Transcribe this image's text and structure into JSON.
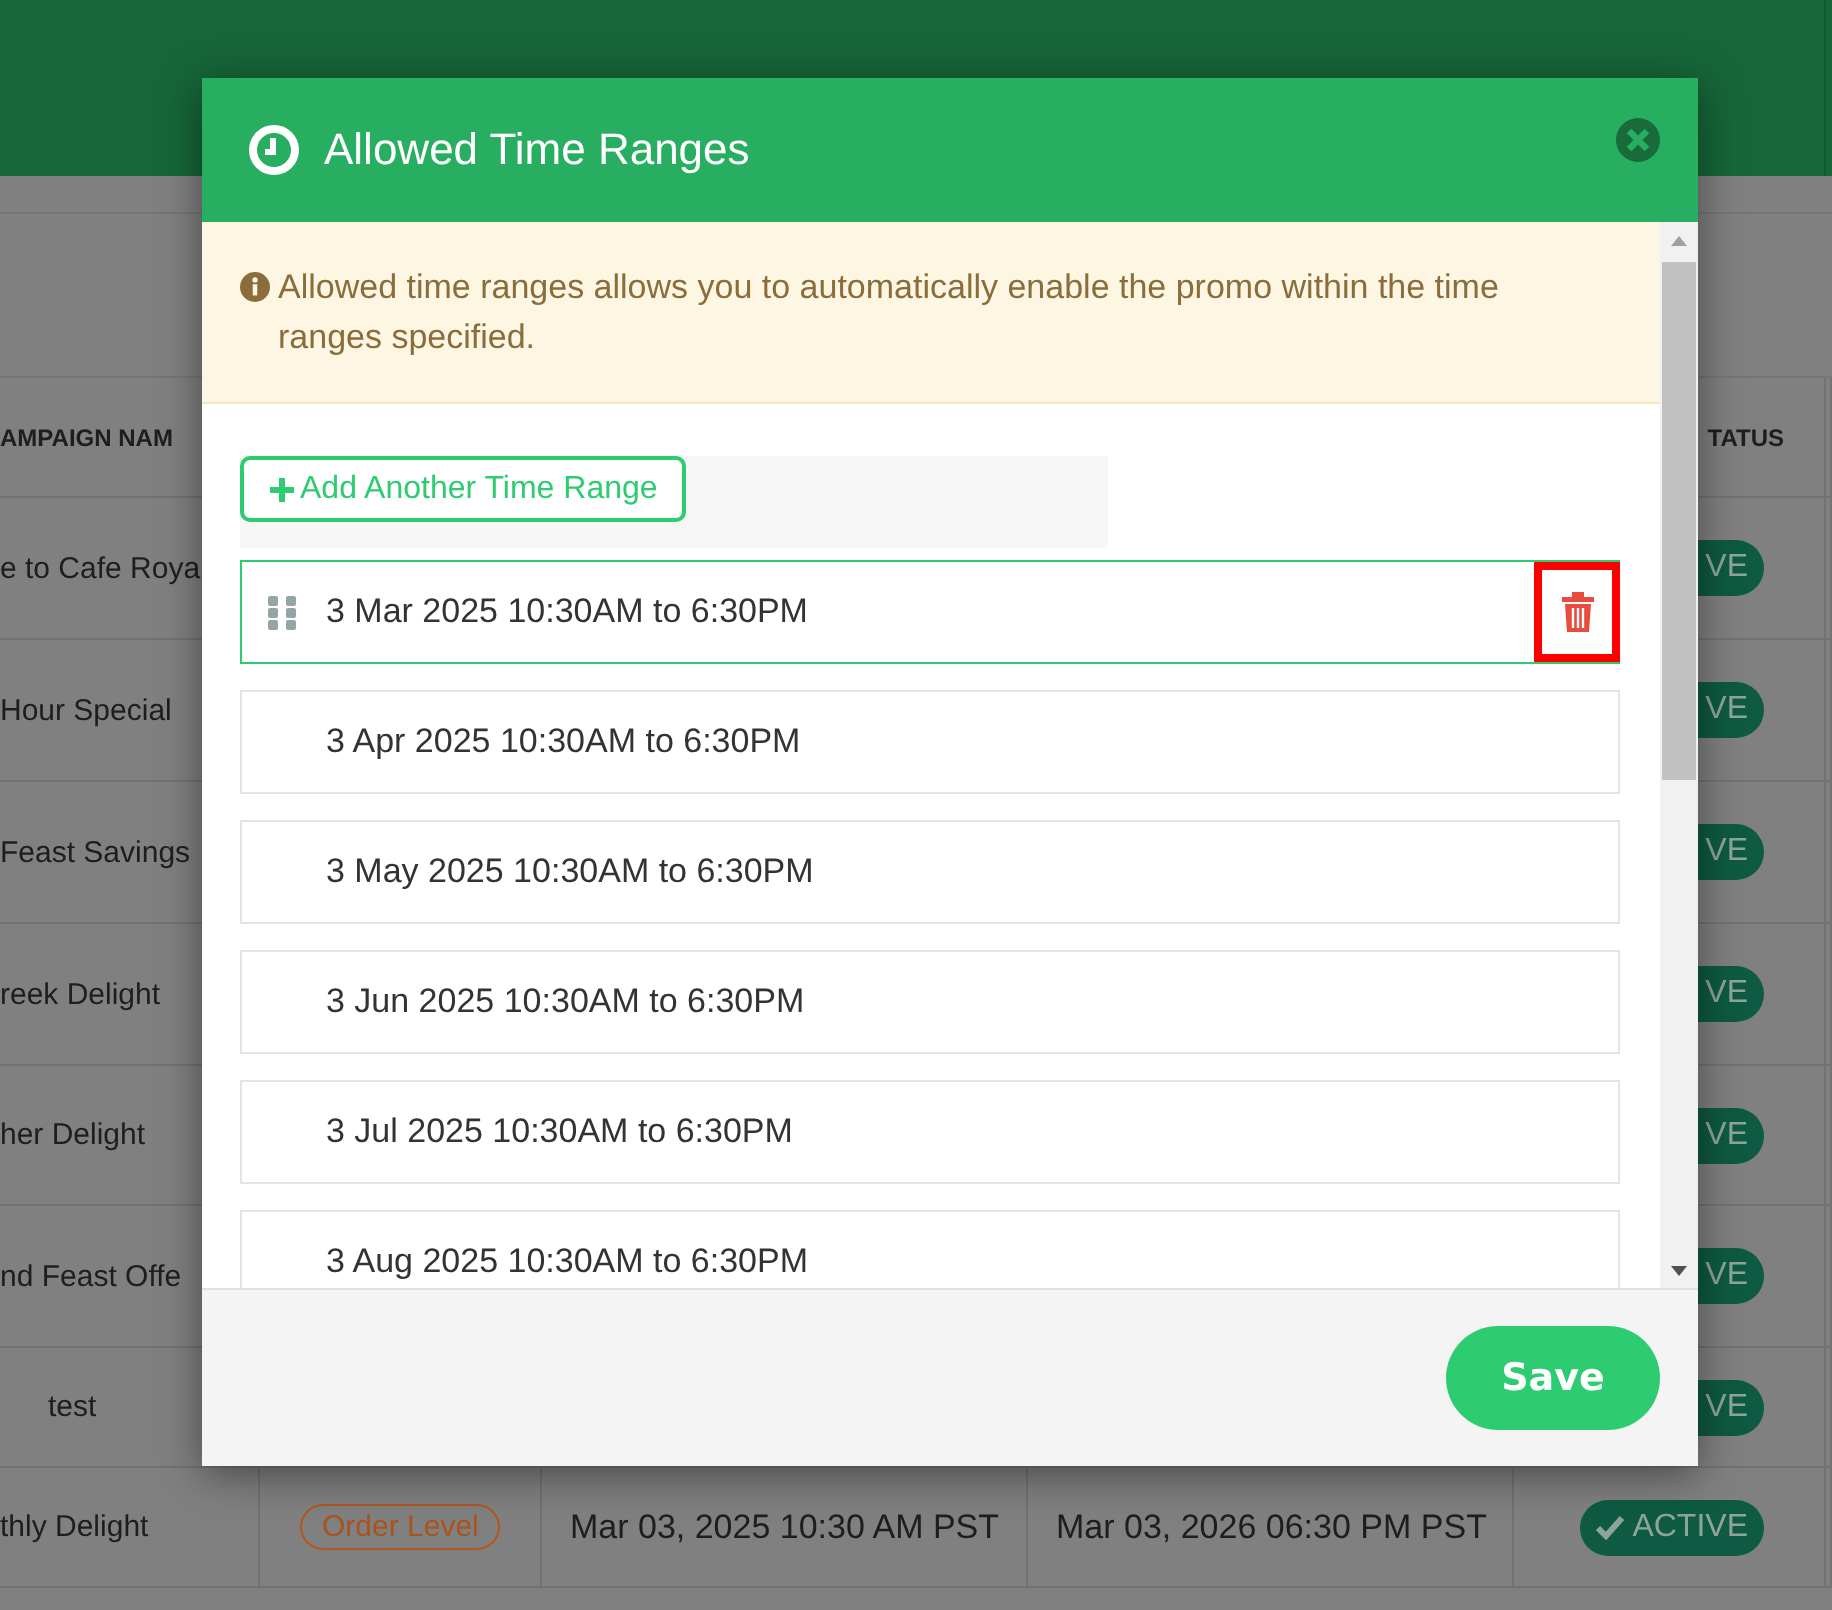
{
  "background_table": {
    "columns": [
      {
        "label": "AMPAIGN NAM"
      },
      {
        "label": "TATUS"
      }
    ],
    "rows": [
      {
        "name": "e to Cafe Roya",
        "status": "VE"
      },
      {
        "name": "Hour Special",
        "status": "VE"
      },
      {
        "name": "Feast Savings",
        "status": "VE"
      },
      {
        "name": "reek Delight",
        "status": "VE"
      },
      {
        "name": "her Delight",
        "status": "VE"
      },
      {
        "name": "nd Feast Offe",
        "status": "VE"
      },
      {
        "name": "test",
        "status": "VE"
      },
      {
        "name": "thly Delight",
        "type": "Order Level",
        "start": "Mar 03, 2025 10:30 AM PST",
        "end": "Mar 03, 2026 06:30 PM PST",
        "status": "ACTIVE"
      }
    ]
  },
  "modal": {
    "title": "Allowed Time Ranges",
    "notice": "Allowed time ranges allows you to automatically enable the promo within the time ranges specified.",
    "add_button": "Add Another Time Range",
    "ranges": [
      {
        "label": "3 Mar 2025 10:30AM to 6:30PM",
        "selected": true,
        "delete_highlighted": true
      },
      {
        "label": "3 Apr 2025 10:30AM to 6:30PM",
        "selected": false
      },
      {
        "label": "3 May 2025 10:30AM to 6:30PM",
        "selected": false
      },
      {
        "label": "3 Jun 2025 10:30AM to 6:30PM",
        "selected": false
      },
      {
        "label": "3 Jul 2025 10:30AM to 6:30PM",
        "selected": false
      },
      {
        "label": "3 Aug 2025 10:30AM to 6:30PM",
        "selected": false
      }
    ],
    "save_button": "Save"
  }
}
